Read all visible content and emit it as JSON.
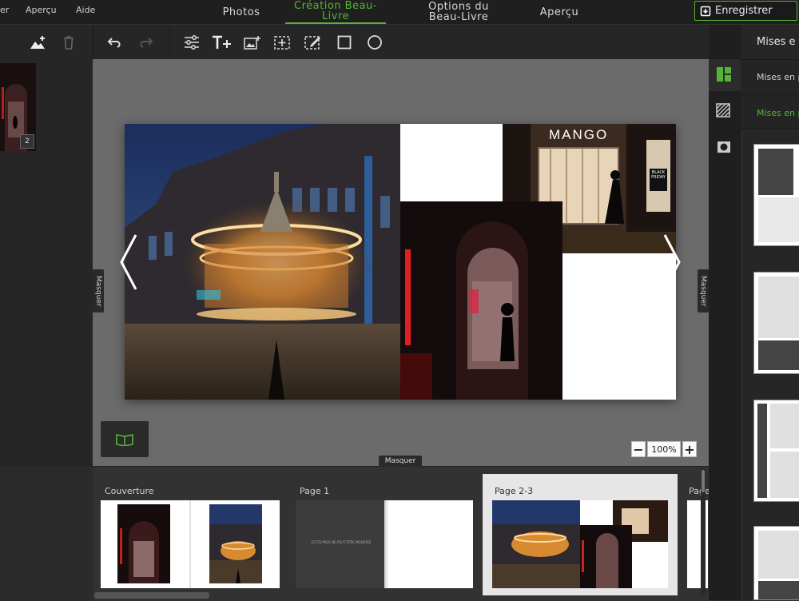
{
  "menu": [
    "er",
    "Aperçu",
    "Aide"
  ],
  "nav": [
    {
      "label": "Photos"
    },
    {
      "label": "Création Beau-Livre"
    },
    {
      "label": "Options du Beau-Livre"
    },
    {
      "label": "Aperçu"
    }
  ],
  "save_label": "Enregistrer",
  "left_panel": {
    "thumb_badge": "2"
  },
  "canvas": {
    "hide_left": "Masquer",
    "hide_right": "Masquer",
    "hide_bottom": "Masquer",
    "zoom": "100%",
    "store_sign": "MANGO",
    "store_sign2": "BLACK FRIDAY"
  },
  "pages": [
    {
      "label": "Couverture"
    },
    {
      "label": "Page 1",
      "blank_text": "CETTE PAGE NE PEUT ÊTRE MODIFIÉE"
    },
    {
      "label": "Page 2-3"
    },
    {
      "label": "Page"
    }
  ],
  "right_panel": {
    "title": "Mises e",
    "tab1": "Mises en p",
    "tab2": "Mises en p"
  },
  "colors": {
    "accent": "#55b435",
    "canvas_bg": "#6b6b6b"
  }
}
